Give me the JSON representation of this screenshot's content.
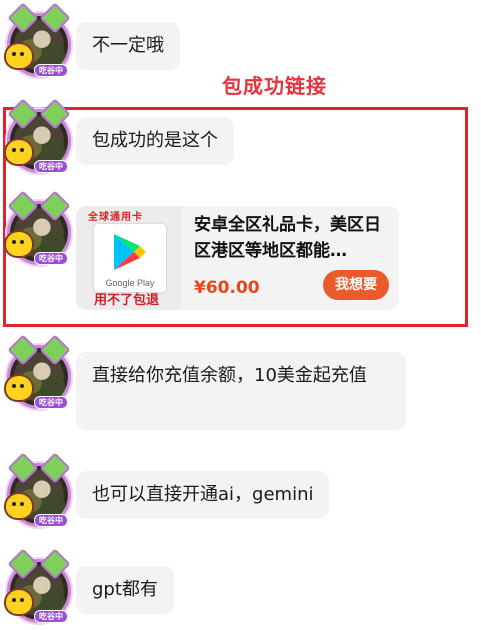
{
  "annotation": {
    "label": "包成功链接"
  },
  "avatar": {
    "badge": "吃谷中"
  },
  "messages": [
    {
      "text": "不一定哦"
    },
    {
      "text": "包成功的是这个"
    },
    {
      "text": "直接给你充值余额，10美金起充值"
    },
    {
      "text": "也可以直接开通ai，gemini"
    },
    {
      "text": "gpt都有"
    }
  ],
  "product_card": {
    "thumb_top_label": "全球通用卡",
    "thumb_logo_text": "Google Play",
    "thumb_bottom_label": "用不了包退",
    "title": "安卓全区礼品卡，美区日区港区等地区都能…",
    "price": "¥60.00",
    "want_button": "我想要"
  },
  "colors": {
    "highlight_border": "#e4212b",
    "annotation_text": "#e8323c",
    "price": "#e8461e",
    "want_button_bg": "#ea5a2a",
    "bubble_bg": "#f3f3f3"
  }
}
